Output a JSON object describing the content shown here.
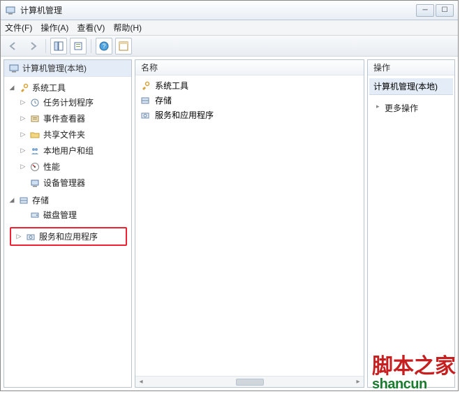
{
  "title": "计算机管理",
  "menu": {
    "file": "文件(F)",
    "action": "操作(A)",
    "view": "查看(V)",
    "help": "帮助(H)"
  },
  "tree": {
    "root": "计算机管理(本地)",
    "system_tools": "系统工具",
    "task_scheduler": "任务计划程序",
    "event_viewer": "事件查看器",
    "shared_folders": "共享文件夹",
    "local_users": "本地用户和组",
    "performance": "性能",
    "device_manager": "设备管理器",
    "storage": "存储",
    "disk_management": "磁盘管理",
    "services_apps": "服务和应用程序"
  },
  "center": {
    "column_name": "名称",
    "items": {
      "system_tools": "系统工具",
      "storage": "存储",
      "services_apps": "服务和应用程序"
    }
  },
  "actions": {
    "header": "操作",
    "group_title": "计算机管理(本地)",
    "more_actions": "更多操作"
  },
  "watermark": {
    "top": "脚本之家",
    "bottom": "shancun"
  }
}
